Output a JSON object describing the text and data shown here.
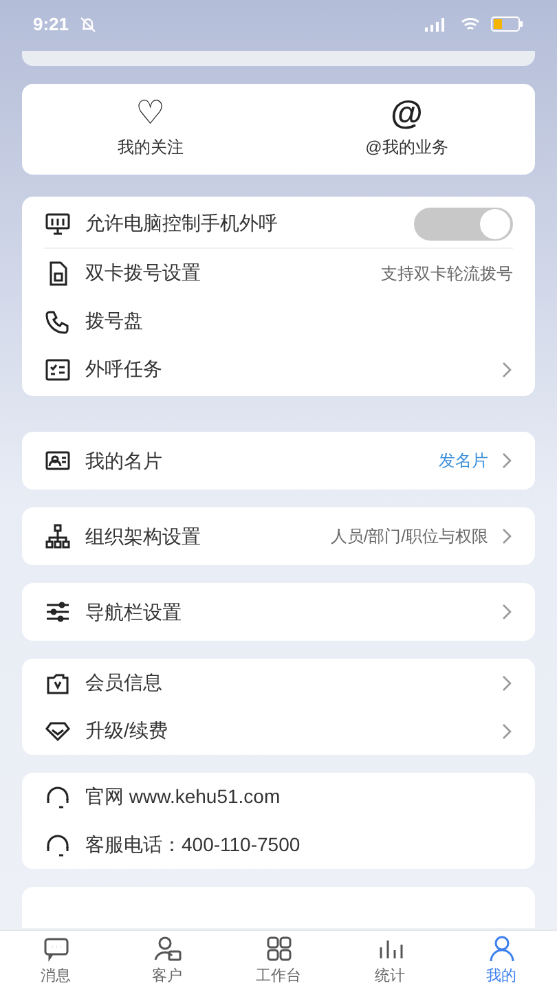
{
  "status_bar": {
    "time": "9:21"
  },
  "quick_actions": [
    {
      "label": "我的关注",
      "icon": "♡"
    },
    {
      "label": "@我的业务",
      "icon": "@"
    }
  ],
  "sections": [
    {
      "rows": [
        {
          "kind": "toggle",
          "label": "允许电脑控制手机外呼",
          "on": true,
          "disabled": true
        },
        {
          "kind": "value",
          "label": "双卡拨号设置",
          "value": "支持双卡轮流拨号"
        },
        {
          "kind": "plain",
          "label": "拨号盘"
        },
        {
          "kind": "link",
          "label": "外呼任务"
        }
      ]
    },
    {
      "rows": [
        {
          "kind": "link",
          "label": "我的名片",
          "value": "发名片",
          "color": "#3b8fd9"
        }
      ]
    },
    {
      "rows": [
        {
          "kind": "link",
          "label": "组织架构设置",
          "value": "人员/部门/职位与权限"
        }
      ]
    },
    {
      "rows": [
        {
          "kind": "link",
          "label": "导航栏设置"
        }
      ]
    },
    {
      "rows": [
        {
          "kind": "link",
          "label": "会员信息"
        },
        {
          "kind": "link",
          "label": "升级/续费"
        }
      ]
    },
    {
      "rows": [
        {
          "kind": "plain",
          "label": "官网 www.kehu51.com"
        },
        {
          "kind": "plain",
          "label": "客服电话：400-110-7500"
        }
      ]
    }
  ],
  "tab_bar": [
    {
      "label": "消息",
      "selected": false
    },
    {
      "label": "客户",
      "selected": false
    },
    {
      "label": "工作台",
      "selected": false
    },
    {
      "label": "统计",
      "selected": false
    },
    {
      "label": "我的",
      "selected": true
    }
  ]
}
